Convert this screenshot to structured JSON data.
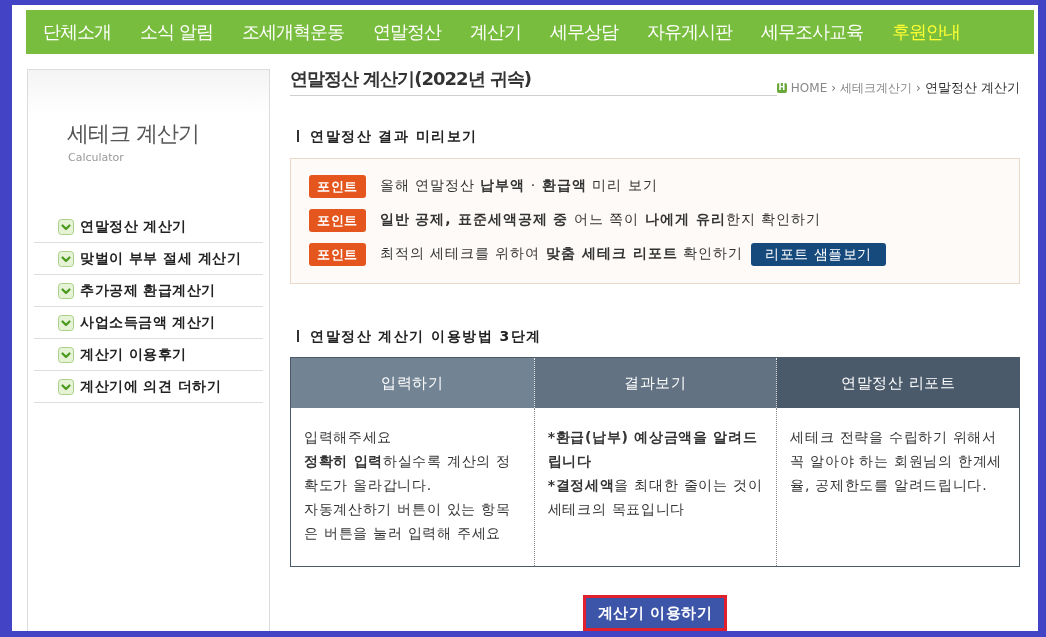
{
  "nav": {
    "items": [
      {
        "label": "단체소개",
        "color": "#ffffff"
      },
      {
        "label": "소식 알림",
        "color": "#ffffff"
      },
      {
        "label": "조세개혁운동",
        "color": "#ffffff"
      },
      {
        "label": "연말정산",
        "color": "#ffffff"
      },
      {
        "label": "계산기",
        "color": "#ffffff"
      },
      {
        "label": "세무상담",
        "color": "#ffffff"
      },
      {
        "label": "자유게시판",
        "color": "#ffffff"
      },
      {
        "label": "세무조사교육",
        "color": "#ffffff"
      },
      {
        "label": "후원안내",
        "color": "#ffff33"
      }
    ]
  },
  "sidebar": {
    "title": "세테크 계산기",
    "subtitle": "Calculator",
    "items": [
      {
        "label": "연말정산 계산기"
      },
      {
        "label": "맞벌이 부부 절세 계산기"
      },
      {
        "label": "추가공제 환급계산기"
      },
      {
        "label": "사업소득금액 계산기"
      },
      {
        "label": "계산기 이용후기"
      },
      {
        "label": "계산기에 의견 더하기"
      }
    ]
  },
  "page_header": {
    "title": "연말정산 계산기(2022년 귀속)",
    "breadcrumb": {
      "icon_text": "H",
      "items": [
        {
          "kind": "link",
          "text": "HOME"
        },
        {
          "kind": "separator",
          "text": "›"
        },
        {
          "kind": "link",
          "text": "세테크계산기"
        },
        {
          "kind": "separator",
          "text": "›"
        },
        {
          "kind": "current",
          "text": "연말정산 계산기"
        }
      ]
    }
  },
  "preview_section": {
    "heading": "연말정산 결과 미리보기",
    "points": [
      {
        "badge": "포인트",
        "text": "올해 연말정산 **납부액** · **환급액** 미리 보기"
      },
      {
        "badge": "포인트",
        "text": "**일반 공제, 표준세액공제 중** 어느 쪽이 **나에게 유리**한지 확인하기"
      },
      {
        "badge": "포인트",
        "text": "최적의 세테크를 위하여 **맞춤 세테크 리포트** 확인하기",
        "button": "리포트 샘플보기"
      }
    ]
  },
  "steps_section": {
    "heading": "연말정산 계산기 이용방법 3단계",
    "columns": [
      {
        "title": "입력하기",
        "color": "#728393",
        "paragraphs": [
          {
            "text": "입력해주세요",
            "bold": false
          },
          {
            "text": "**정확히 입력**하실수록 계산의 정확도가 올라갑니다.",
            "bold": false
          },
          {
            "text": "자동계산하기 버튼이 있는 항목은 버튼을 눌러 입력해 주세요",
            "bold": false
          }
        ]
      },
      {
        "title": "결과보기",
        "color": "#627282",
        "paragraphs": [
          {
            "text": "*환급(납부) 예상금액을 알려드립니다",
            "bold": true
          },
          {
            "text": "***결정세액**을 최대한 줄이는 것이 세테크의 목표입니다",
            "bold": false
          }
        ]
      },
      {
        "title": "연말정산 리포트",
        "color": "#4b5a6b",
        "paragraphs": [
          {
            "text": "세테크 전략을 수립하기 위해서 꼭 알아야 하는 회원님의 한계세율, 공제한도를 알려드립니다.",
            "bold": false
          }
        ]
      }
    ]
  },
  "cta_button": "계산기 이용하기"
}
